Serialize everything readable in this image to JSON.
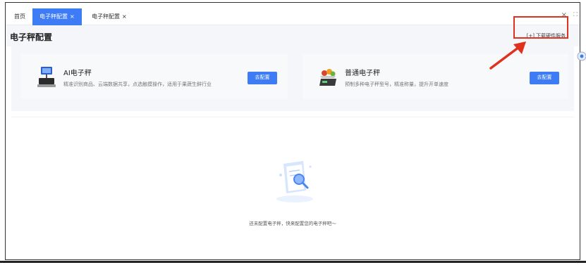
{
  "tabs": [
    {
      "label": "首页",
      "closable": false,
      "active": false
    },
    {
      "label": "电子秤配置",
      "closable": true,
      "active": true
    },
    {
      "label": "电子秤配置",
      "closable": true,
      "active": false
    }
  ],
  "tab_close_glyph": "×",
  "window": {
    "close_glyph": "×",
    "expand_glyph": "⛶"
  },
  "page": {
    "title": "电子秤配置",
    "download_icon": "[+]",
    "download_label": "下载硬件服务"
  },
  "cards": [
    {
      "name": "AI电子秤",
      "desc": "精准识别商品、云端数据共享，点选触摸操作，适用于果蔬生鲜行业",
      "button": "去配置",
      "icon": "monitor-scale-icon"
    },
    {
      "name": "普通电子秤",
      "desc": "预制多种电子秤型号，精准称量，提升开单速度",
      "button": "去配置",
      "icon": "weighing-scale-icon"
    }
  ],
  "empty_state": {
    "text": "还未配置电子秤，快来配置您的电子秤吧～",
    "icon": "empty-search-document-icon"
  },
  "colors": {
    "accent": "#3d7cf5",
    "annotation": "#e0301e",
    "band": "#f4f6fa"
  }
}
